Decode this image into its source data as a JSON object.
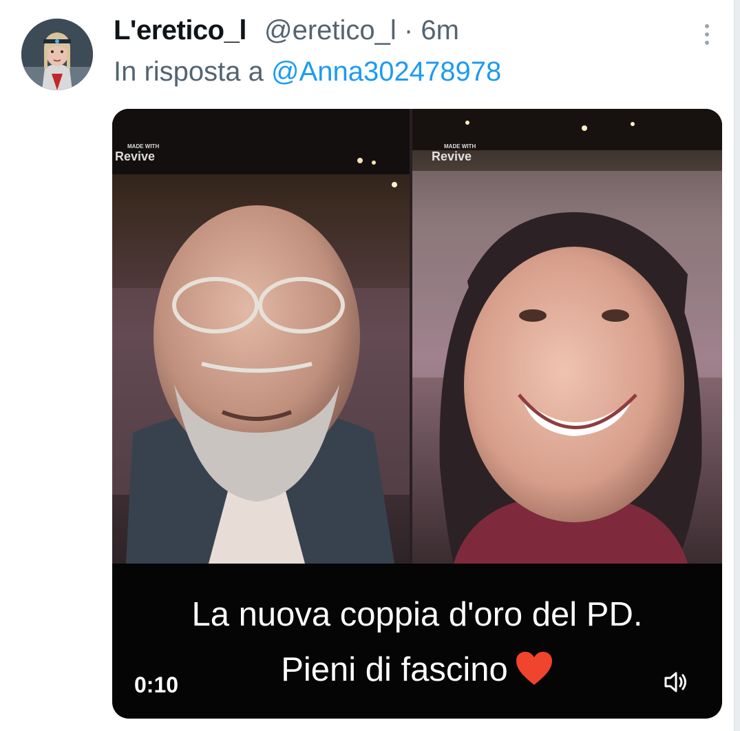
{
  "tweet": {
    "display_name": "L'eretico_l",
    "handle": "@eretico_l",
    "separator": "·",
    "time": "6m",
    "reply_prefix": "In risposta a",
    "reply_to": "@Anna302478978"
  },
  "media": {
    "type": "video",
    "caption_line1": "La nuova coppia d'oro del PD.",
    "caption_line2": "Pieni di fascino",
    "timer": "0:10",
    "watermark_small": "MADE WITH",
    "watermark_brand": "Revive"
  },
  "icons": {
    "more": "more-vertical-icon",
    "heart": "red-heart-icon",
    "volume": "volume-icon"
  },
  "colors": {
    "link": "#1d9bf0",
    "secondary_text": "#536471",
    "primary_text": "#0f1419",
    "heart": "#f0442c"
  }
}
